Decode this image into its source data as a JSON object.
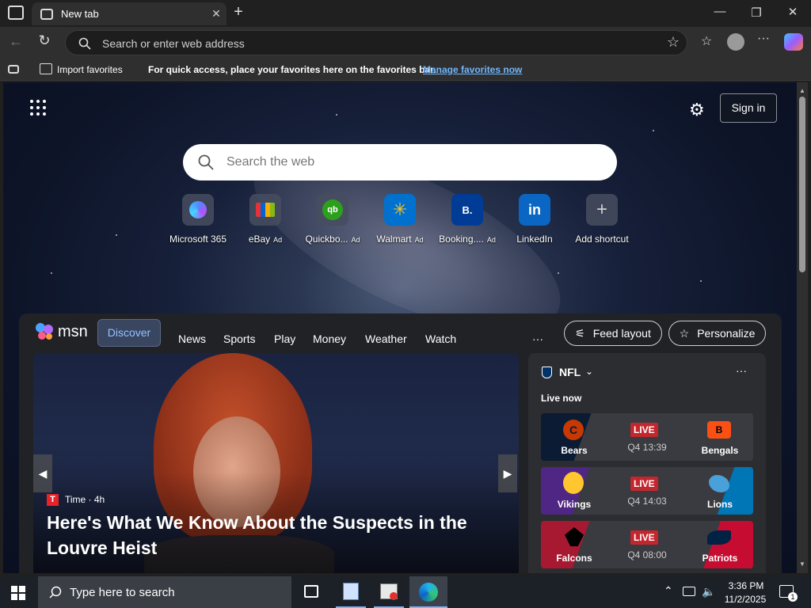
{
  "browser": {
    "tab_title": "New tab",
    "address_placeholder": "Search or enter web address",
    "favorites_bar": {
      "import_label": "Import favorites",
      "message": "For quick access, place your favorites here on the favorites bar.",
      "manage_link": "Manage favorites now"
    }
  },
  "newtab": {
    "sign_in": "Sign in",
    "search_placeholder": "Search the web",
    "shortcuts": [
      {
        "name": "Microsoft 365",
        "ad": "",
        "icon": "microsoft365-icon"
      },
      {
        "name": "eBay",
        "ad": "Ad",
        "icon": "ebay-icon"
      },
      {
        "name": "Quickbo...",
        "ad": "Ad",
        "icon": "quickbooks-icon"
      },
      {
        "name": "Walmart",
        "ad": "Ad",
        "icon": "walmart-icon"
      },
      {
        "name": "Booking....",
        "ad": "Ad",
        "icon": "booking-icon"
      },
      {
        "name": "LinkedIn",
        "ad": "",
        "icon": "linkedin-icon"
      },
      {
        "name": "Add shortcut",
        "ad": "",
        "icon": "plus-icon"
      }
    ]
  },
  "msn": {
    "logo_text": "msn",
    "nav": [
      "Discover",
      "News",
      "Sports",
      "Play",
      "Money",
      "Weather",
      "Watch"
    ],
    "more": "···",
    "feed_layout": "Feed layout",
    "personalize": "Personalize",
    "hero": {
      "source_letter": "T",
      "source": "Time · 4h",
      "headline": "Here's What We Know About the Suspects in the Louvre Heist"
    },
    "nfl": {
      "title": "NFL",
      "live_now": "Live now",
      "live_badge": "LIVE",
      "games": [
        {
          "home": "Bears",
          "away": "Bengals",
          "clock": "Q4 13:39",
          "home_color": "#0b1b33",
          "away_color": "#fb4f14"
        },
        {
          "home": "Vikings",
          "away": "Lions",
          "clock": "Q4 14:03",
          "home_color": "#4f2683",
          "away_color": "#0076b6"
        },
        {
          "home": "Falcons",
          "away": "Patriots",
          "clock": "Q4 08:00",
          "home_color": "#a71930",
          "away_color": "#c60c30"
        }
      ]
    }
  },
  "taskbar": {
    "search_placeholder": "Type here to search",
    "time": "3:36 PM",
    "date": "11/2/2025",
    "notification_count": "1"
  }
}
